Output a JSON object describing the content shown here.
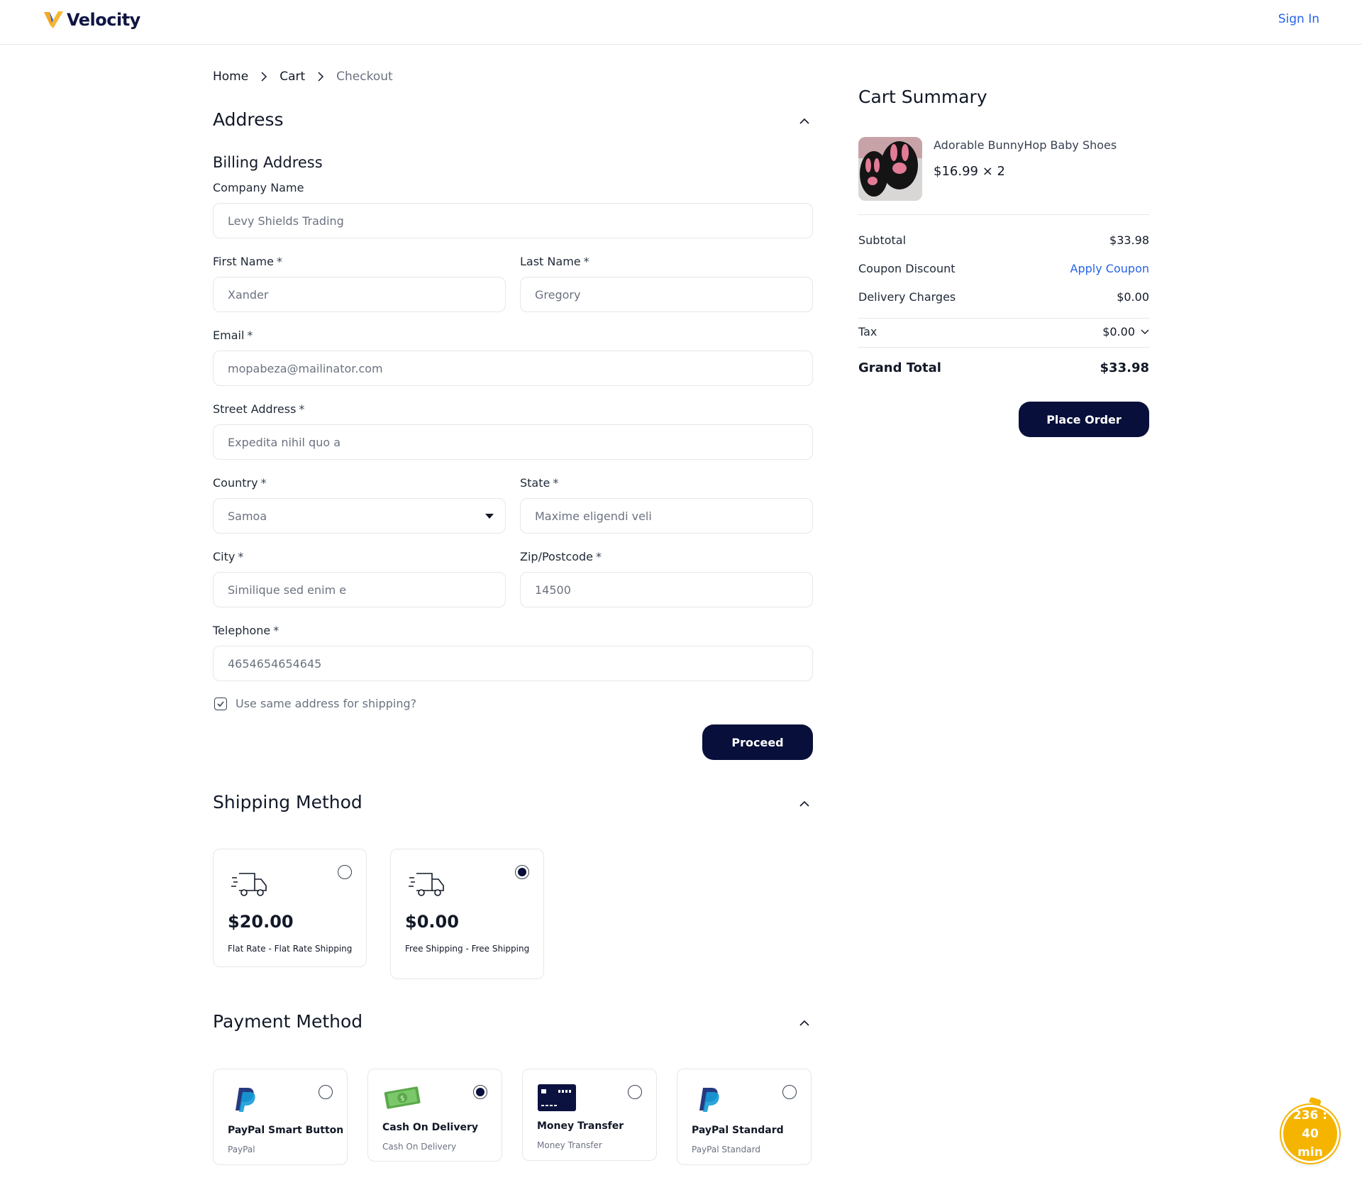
{
  "header": {
    "brand": "Velocity",
    "signin_label": "Sign In"
  },
  "breadcrumb": {
    "items": [
      "Home",
      "Cart"
    ],
    "current": "Checkout"
  },
  "address": {
    "title": "Address",
    "billing_title": "Billing Address",
    "fields": {
      "company": {
        "label": "Company Name",
        "value": "Levy Shields Trading"
      },
      "first_name": {
        "label": "First Name",
        "value": "Xander"
      },
      "last_name": {
        "label": "Last Name",
        "value": "Gregory"
      },
      "email": {
        "label": "Email",
        "value": "mopabeza@mailinator.com"
      },
      "street": {
        "label": "Street Address",
        "value": "Expedita nihil quo a"
      },
      "country": {
        "label": "Country",
        "value": "Samoa"
      },
      "state": {
        "label": "State",
        "value": "Maxime eligendi veli"
      },
      "city": {
        "label": "City",
        "value": "Similique sed enim e"
      },
      "zip": {
        "label": "Zip/Postcode",
        "value": "14500"
      },
      "telephone": {
        "label": "Telephone",
        "value": "4654654654645"
      }
    },
    "required_mark": "*",
    "same_address_label": "Use same address for shipping?",
    "same_address_checked": true,
    "proceed_label": "Proceed"
  },
  "shipping": {
    "title": "Shipping Method",
    "options": [
      {
        "price": "$20.00",
        "description": "Flat Rate - Flat Rate Shipping",
        "selected": false,
        "icon": "truck-icon"
      },
      {
        "price": "$0.00",
        "description": "Free Shipping - Free Shipping",
        "selected": true,
        "icon": "truck-icon"
      }
    ]
  },
  "payment": {
    "title": "Payment Method",
    "options": [
      {
        "title": "PayPal Smart Button",
        "subtitle": "PayPal",
        "selected": false,
        "icon": "paypal-icon"
      },
      {
        "title": "Cash On Delivery",
        "subtitle": "Cash On Delivery",
        "selected": true,
        "icon": "cash-icon"
      },
      {
        "title": "Money Transfer",
        "subtitle": "Money Transfer",
        "selected": false,
        "icon": "card-icon"
      },
      {
        "title": "PayPal Standard",
        "subtitle": "PayPal Standard",
        "selected": false,
        "icon": "paypal-icon"
      }
    ]
  },
  "cart_summary": {
    "title": "Cart Summary",
    "item": {
      "name": "Adorable BunnyHop Baby Shoes",
      "price_qty": "$16.99 × 2"
    },
    "subtotal_label": "Subtotal",
    "subtotal_value": "$33.98",
    "coupon_label": "Coupon Discount",
    "coupon_action": "Apply Coupon",
    "delivery_label": "Delivery Charges",
    "delivery_value": "$0.00",
    "tax_label": "Tax",
    "tax_value": "$0.00",
    "grand_total_label": "Grand Total",
    "grand_total_value": "$33.98",
    "place_order_label": "Place Order"
  },
  "timer": {
    "value": "236 : 40",
    "unit": "min"
  },
  "colors": {
    "brand_navy": "#080f3a",
    "link_blue": "#2563eb",
    "timer_yellow": "#f4b400",
    "logo_orange": "#f5a623"
  }
}
